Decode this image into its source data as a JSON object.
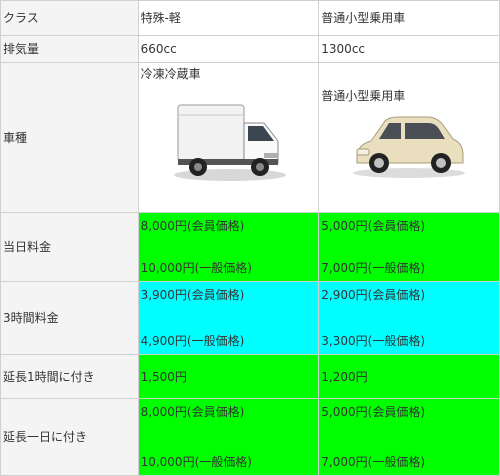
{
  "header": {
    "label": "クラス",
    "col1": "特殊-軽",
    "col2": "普通小型乗用車"
  },
  "displacement": {
    "label": "排気量",
    "col1": "660cc",
    "col2": "1300cc"
  },
  "vehicle": {
    "label": "車種",
    "col1": "冷凍冷蔵車",
    "col2": "普通小型乗用車",
    "col1_image": "refrigerated-mini-truck",
    "col2_image": "compact-car-beige"
  },
  "day_rate": {
    "label": "当日料金",
    "col1": [
      "8,000円(会員価格)",
      "10,000円(一般価格)"
    ],
    "col2": [
      "5,000円(会員価格)",
      "7,000円(一般価格)"
    ]
  },
  "three_hour_rate": {
    "label": "3時間料金",
    "col1": [
      "3,900円(会員価格)",
      "4,900円(一般価格)"
    ],
    "col2": [
      "2,900円(会員価格)",
      "3,300円(一般価格)"
    ]
  },
  "extension_hour": {
    "label": "延長1時間に付き",
    "col1": "1,500円",
    "col2": "1,200円"
  },
  "extension_day": {
    "label": "延長一日に付き",
    "col1": [
      "8,000円(会員価格)",
      "10,000円(一般価格)"
    ],
    "col2": [
      "5,000円(会員価格)",
      "7,000円(一般価格)"
    ]
  },
  "colors": {
    "green": "#00ff00",
    "cyan": "#00ffff",
    "border": "#d0d0d0"
  }
}
